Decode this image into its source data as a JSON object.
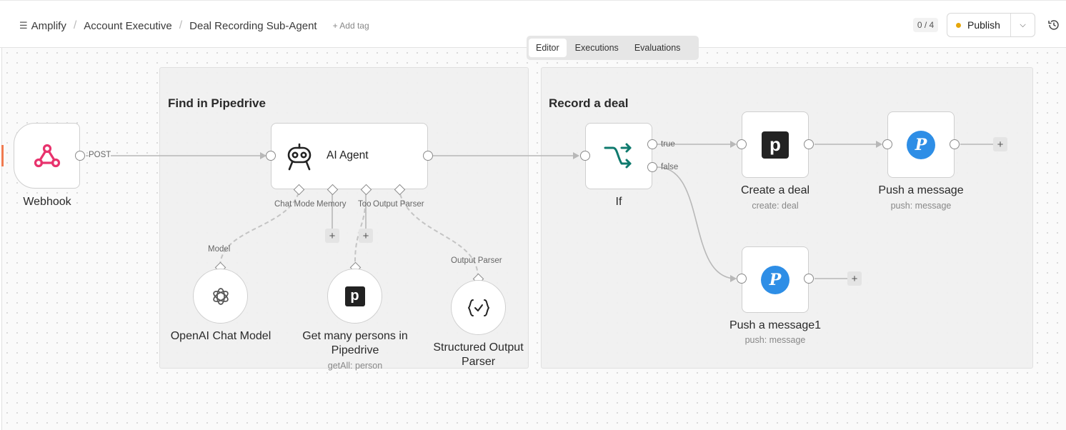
{
  "breadcrumb": {
    "project": "Amplify",
    "folder": "Account Executive",
    "workflow": "Deal Recording Sub-Agent",
    "add_tag": "+ Add tag"
  },
  "header": {
    "counter": "0 / 4",
    "publish_label": "Publish",
    "publish_status_color": "#e6a70b"
  },
  "tabs": [
    {
      "label": "Editor",
      "active": true
    },
    {
      "label": "Executions",
      "active": false
    },
    {
      "label": "Evaluations",
      "active": false
    }
  ],
  "groups": {
    "find": {
      "title": "Find in Pipedrive"
    },
    "record": {
      "title": "Record a deal"
    }
  },
  "nodes": {
    "webhook": {
      "name": "Webhook",
      "icon": "webhook-icon",
      "output_label": "POST",
      "color": "#e8336d"
    },
    "ai_agent": {
      "name": "AI Agent",
      "icon": "robot-icon",
      "inputs": [
        "Chat Model",
        "Memory",
        "Tool",
        "Output Parser"
      ],
      "input_labels_shown": [
        "Chat Mode",
        "Memory",
        "Too",
        "Output Parser"
      ]
    },
    "openai": {
      "name": "OpenAI Chat Model",
      "icon": "openai-icon",
      "connector": "Model"
    },
    "get_persons": {
      "name": "Get many persons in Pipedrive",
      "sub": "getAll: person",
      "icon": "pipedrive-icon"
    },
    "structured": {
      "name": "Structured Output Parser",
      "icon": "json-check-icon",
      "connector": "Output Parser"
    },
    "if": {
      "name": "If",
      "icon": "branch-icon",
      "true_label": "true",
      "false_label": "false",
      "color": "#0f7a6e"
    },
    "create_deal": {
      "name": "Create a deal",
      "sub": "create: deal",
      "icon": "pipedrive-icon"
    },
    "push": {
      "name": "Push a message",
      "sub": "push: message",
      "icon": "pushbullet-icon"
    },
    "push1": {
      "name": "Push a message1",
      "sub": "push: message",
      "icon": "pushbullet-icon"
    }
  },
  "add_symbol": "+"
}
